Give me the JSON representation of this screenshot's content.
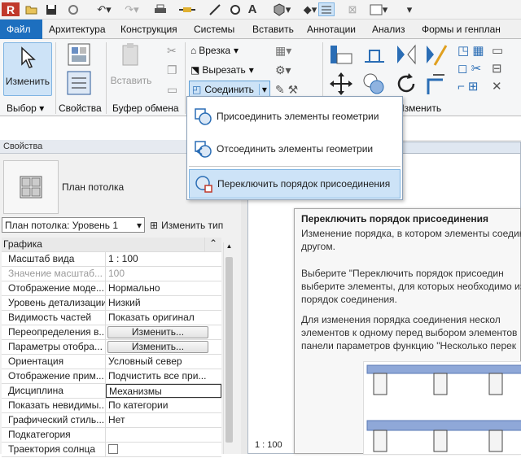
{
  "quick_access": {
    "icons": [
      "revit-logo-icon",
      "open-icon",
      "save-icon",
      "sync-icon",
      "undo-icon",
      "redo-icon",
      "print-icon",
      "measure-icon",
      "dimension-icon",
      "tag-icon",
      "text-icon",
      "3d-view-icon",
      "section-icon",
      "thin-lines-icon",
      "close-hidden-icon",
      "switch-windows-icon"
    ],
    "text_tool": "A",
    "logo": "R"
  },
  "tabs": [
    "Файл",
    "Архитектура",
    "Конструкция",
    "Системы",
    "Вставить",
    "Аннотации",
    "Анализ",
    "Формы и генплан"
  ],
  "ribbon": {
    "modify_label": "Изменить",
    "select_label": "Выбор",
    "properties_label": "Свойства",
    "clipboard_label": "Буфер обмена",
    "paste_label": "Вставить",
    "cope_label": "Врезка",
    "cut_label": "Вырезать",
    "join_label": "Соединить",
    "modify_group_label": "Изменить"
  },
  "join_menu": {
    "items": [
      {
        "label": "Присоединить элементы геометрии",
        "icon": "join-geometry-icon"
      },
      {
        "label": "Отсоединить элементы геометрии",
        "icon": "unjoin-geometry-icon"
      },
      {
        "label": "Переключить порядок присоединения",
        "icon": "switch-join-order-icon"
      }
    ]
  },
  "properties": {
    "panel_title": "Свойства",
    "type_name": "План потолка",
    "selector_value": "План потолка: Уровень 1",
    "edit_type_label": "Изменить тип",
    "category": "Графика",
    "rows": [
      {
        "name": "Масштаб вида",
        "value": "1 : 100"
      },
      {
        "name": "Значение масштаб...",
        "value": "100",
        "dim": true
      },
      {
        "name": "Отображение моде...",
        "value": "Нормально"
      },
      {
        "name": "Уровень детализации",
        "value": "Низкий"
      },
      {
        "name": "Видимость частей",
        "value": "Показать оригинал"
      },
      {
        "name": "Переопределения в...",
        "value": "Изменить...",
        "button": true
      },
      {
        "name": "Параметры отобра...",
        "value": "Изменить...",
        "button": true
      },
      {
        "name": "Ориентация",
        "value": "Условный север"
      },
      {
        "name": "Отображение прим...",
        "value": "Подчистить все при..."
      },
      {
        "name": "Дисциплина",
        "value": "Механизмы",
        "boxed": true
      },
      {
        "name": "Показать невидимы...",
        "value": "По категории"
      },
      {
        "name": "Графический стиль...",
        "value": "Нет"
      },
      {
        "name": "Подкатегория",
        "value": ""
      },
      {
        "name": "Траектория солнца",
        "value": "",
        "checkbox": true
      }
    ]
  },
  "view": {
    "scale": "1 : 100"
  },
  "tooltip": {
    "title": "Переключить порядок присоединения",
    "p1": "Изменение порядка, в котором элементы соедин\nдругом.",
    "p2": "Выберите \"Переключить порядок присоедин\nвыберите элементы, для которых необходимо из\nпорядок соединения.",
    "p3": "Для изменения порядка соединения нескол\nэлементов к одному перед выбором элементов\nпанели параметров функцию \"Несколько перек"
  },
  "colors": {
    "accent": "#1d6fbf",
    "selection": "#cde3f7",
    "diagram_blue": "#8fa8d8"
  }
}
